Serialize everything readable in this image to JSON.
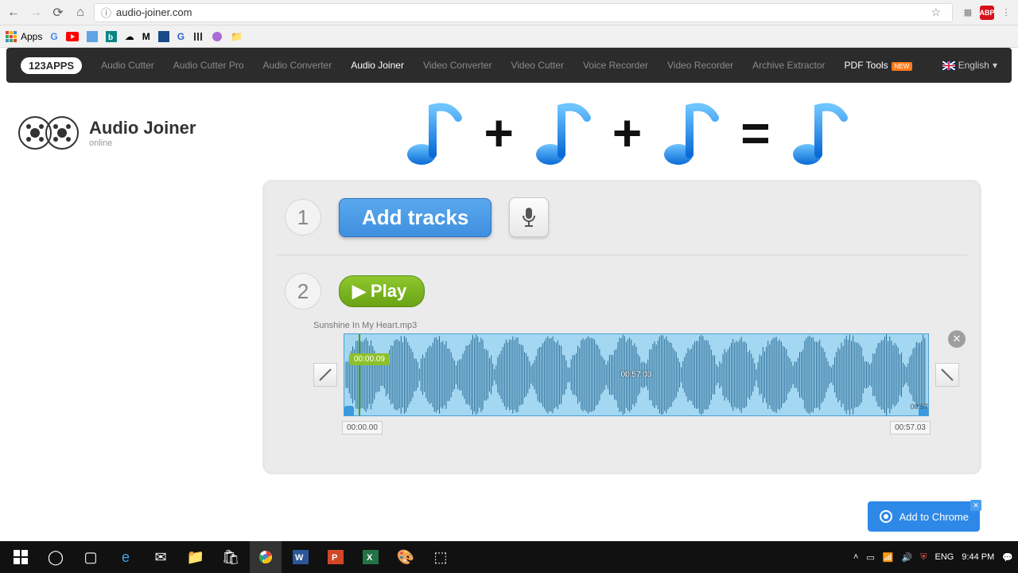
{
  "browser": {
    "url": "audio-joiner.com",
    "apps_label": "Apps",
    "abp_badge": "ABP"
  },
  "nav": {
    "logo": "123APPS",
    "links": [
      "Audio Cutter",
      "Audio Cutter Pro",
      "Audio Converter",
      "Audio Joiner",
      "Video Converter",
      "Video Cutter",
      "Voice Recorder",
      "Video Recorder",
      "Archive Extractor",
      "PDF Tools"
    ],
    "new_label": "NEW",
    "language": "English"
  },
  "header": {
    "title": "Audio Joiner",
    "sub": "online"
  },
  "step1": {
    "num": "1",
    "add_tracks": "Add tracks"
  },
  "step2": {
    "num": "2",
    "play": "Play"
  },
  "track": {
    "filename": "Sunshine In My Heart.mp3",
    "playhead_time": "00:00.09",
    "center_time": "00:57:03",
    "start_time": "00:00.00",
    "end_hint": "00:57",
    "end_time": "00:57.03"
  },
  "add_chrome": "Add to Chrome",
  "taskbar": {
    "lang": "ENG",
    "time": "9:44 PM"
  }
}
